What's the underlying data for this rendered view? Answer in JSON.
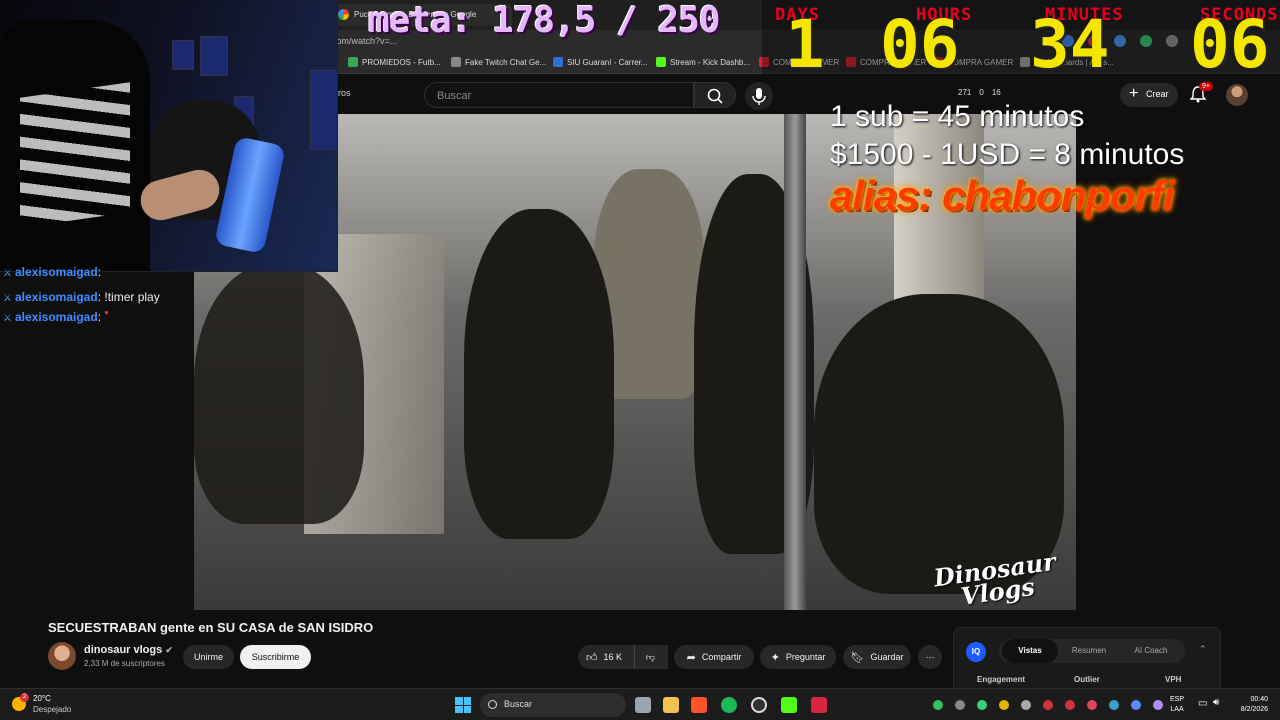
{
  "browser": {
    "active_tab_title": "Puccio family - Buscar con Google",
    "url": "com/watch?v=...",
    "bookmarks": [
      {
        "label": "PROMIEDOS - Futb...",
        "color": "#3aa757"
      },
      {
        "label": "Fake Twitch Chat Ge...",
        "color": "#888888"
      },
      {
        "label": "SIU Guaraní - Carrer...",
        "color": "#2f6fd6"
      },
      {
        "label": "Stream - Kick Dashb...",
        "color": "#53fc18"
      },
      {
        "label": "COMPRA GAMER",
        "color": "#d7262e"
      },
      {
        "label": "COMPRA GAMER",
        "color": "#d7262e"
      },
      {
        "label": "COMPRA GAMER",
        "color": "#d7262e"
      },
      {
        "label": "Motherboards | Asus...",
        "color": "#aaaaaa"
      }
    ]
  },
  "youtube": {
    "crumb": "ros",
    "search_placeholder": "Buscar",
    "stats": [
      "271",
      "0",
      "16"
    ],
    "create_label": "Crear",
    "notif_badge": "9+",
    "video_title": "SECUESTRABAN gente en SU CASA de SAN ISIDRO",
    "channel_name": "dinosaur vlogs",
    "channel_subs": "2,33 M de suscriptores",
    "join_label": "Unirme",
    "subscribe_label": "Suscribirme",
    "likes": "16 K",
    "share_label": "Compartir",
    "ask_label": "Preguntar",
    "save_label": "Guardar",
    "watermark_line1": "Dinosaur",
    "watermark_line2": "Vlogs"
  },
  "overlay": {
    "meta": "meta: 178,5 / 250",
    "timer_labels": {
      "days": "DAYS",
      "hours": "HOURS",
      "minutes": "MINUTES",
      "seconds": "SECONDS"
    },
    "timer_values": {
      "days": "1",
      "hours": "06",
      "minutes": "34",
      "seconds": "06"
    },
    "line1": "1 sub = 45 minutos",
    "line2": "$1500 - 1USD = 8 minutos",
    "alias": "alias: chabonporfi"
  },
  "chat": [
    {
      "user": "alexisomaigad",
      "message": ""
    },
    {
      "user": "alexisomaigad",
      "message": "!timer play"
    },
    {
      "user": "alexisomaigad",
      "message": ""
    }
  ],
  "panel": {
    "logo": "IQ",
    "tabs": [
      "Vistas",
      "Resumen",
      "AI Coach"
    ],
    "columns": [
      "Engagement",
      "Outlier",
      "VPH"
    ]
  },
  "taskbar": {
    "temperature": "20°C",
    "condition": "Despejado",
    "weather_badge": "2",
    "search_label": "Buscar",
    "lang_line1": "ESP",
    "lang_line2": "LAA",
    "time": "00:40",
    "date": "8/2/2026"
  }
}
